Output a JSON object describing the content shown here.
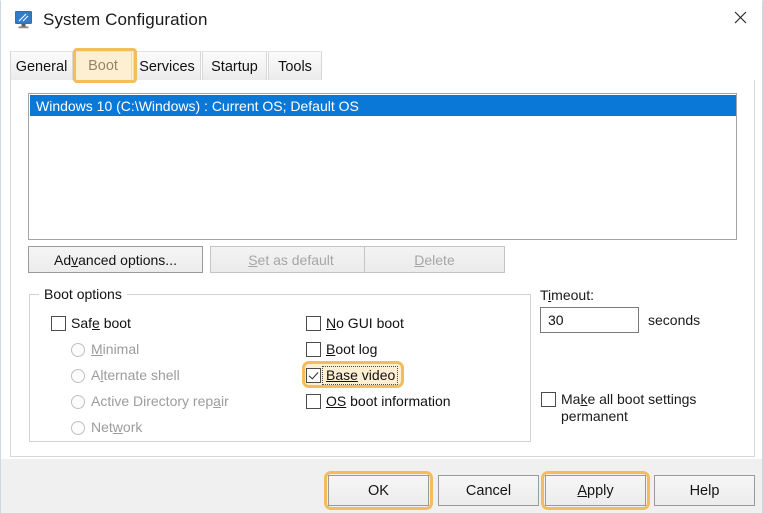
{
  "window": {
    "title": "System Configuration",
    "icon": "computer-monitor-icon",
    "close_label": "✕"
  },
  "tabs": [
    {
      "label": "General",
      "active": false
    },
    {
      "label": "Boot",
      "active": true
    },
    {
      "label": "Services",
      "active": false
    },
    {
      "label": "Startup",
      "active": false
    },
    {
      "label": "Tools",
      "active": false
    }
  ],
  "os_list": {
    "items": [
      {
        "text": "Windows 10 (C:\\Windows) : Current OS; Default OS",
        "selected": true
      }
    ]
  },
  "middle_buttons": {
    "advanced": {
      "pre": "Ad",
      "mnemonic": "v",
      "post": "anced options...",
      "enabled": true
    },
    "set_default": {
      "pre": "",
      "mnemonic": "S",
      "post": "et as default",
      "enabled": false
    },
    "delete": {
      "pre": "",
      "mnemonic": "D",
      "post": "elete",
      "enabled": false
    }
  },
  "boot_options": {
    "group_label": "Boot options",
    "safe_boot": {
      "pre": "Saf",
      "mnemonic": "e",
      "post": " boot",
      "checked": false,
      "enabled": true
    },
    "radios": [
      {
        "pre": "",
        "mnemonic": "M",
        "post": "inimal",
        "selected": false,
        "enabled": false
      },
      {
        "pre": "A",
        "mnemonic": "l",
        "post": "ternate shell",
        "selected": false,
        "enabled": false
      },
      {
        "pre": "Active Directory rep",
        "mnemonic": "a",
        "post": "ir",
        "selected": false,
        "enabled": false
      },
      {
        "pre": "Net",
        "mnemonic": "w",
        "post": "ork",
        "selected": false,
        "enabled": false
      }
    ],
    "checkboxes": [
      {
        "pre": "",
        "mnemonic": "N",
        "post": "o GUI boot",
        "checked": false
      },
      {
        "pre": "",
        "mnemonic": "B",
        "post": "oot log",
        "checked": false
      },
      {
        "pre": "",
        "mnemonic": "Base",
        "post": " video",
        "checked": true,
        "highlighted": true,
        "focused": true
      },
      {
        "pre": "",
        "mnemonic": "OS",
        "post": " boot information",
        "checked": false
      }
    ]
  },
  "timeout": {
    "label_pre": "T",
    "label_mnemonic": "i",
    "label_post": "meout:",
    "value": "30",
    "unit": "seconds"
  },
  "permanent": {
    "pre": "Ma",
    "mnemonic": "k",
    "post": "e all boot settings permanent",
    "checked": false
  },
  "dialog_buttons": [
    {
      "label": "OK",
      "highlighted": true
    },
    {
      "label": "Cancel",
      "highlighted": false
    },
    {
      "pre": "",
      "mnemonic": "A",
      "post": "pply",
      "label": "Apply",
      "highlighted": true
    },
    {
      "label": "Help",
      "highlighted": false
    }
  ],
  "colors": {
    "accent_highlight_border": "#f5bc5c",
    "accent_highlight_fill": "#fde1af",
    "selection_blue": "#0a78d7",
    "window_bg": "#ffffff",
    "bottom_bar": "#f0f0f0"
  }
}
